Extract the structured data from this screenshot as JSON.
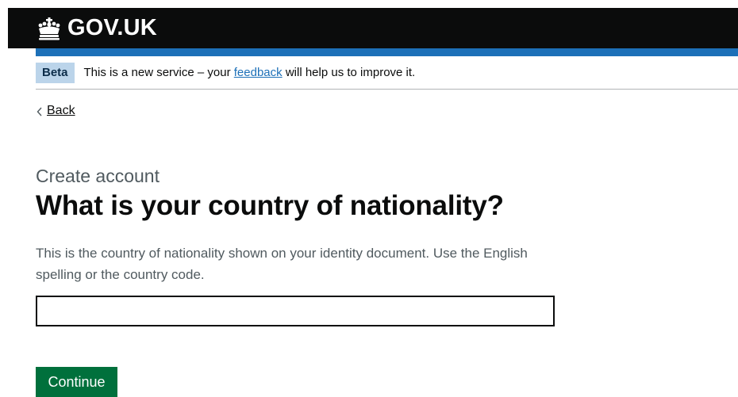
{
  "header": {
    "logo_text": "GOV.UK",
    "logo_icon": "crown-icon",
    "colors": {
      "background": "#0b0c0c",
      "stripe": "#1d70b8"
    }
  },
  "phase_banner": {
    "tag": "Beta",
    "text_before": "This is a new service – your ",
    "link_text": "feedback",
    "text_after": " will help us to improve it."
  },
  "back_link": {
    "label": "Back",
    "icon": "chevron-left-icon"
  },
  "main": {
    "caption": "Create account",
    "title": "What is your country of nationality?",
    "hint": "This is the country of nationality shown on your identity document. Use the English spelling or the country code.",
    "input": {
      "value": "",
      "placeholder": ""
    },
    "continue_label": "Continue"
  },
  "colors": {
    "button": "#00703c",
    "link": "#1d70b8",
    "tag_background": "#bbd4ea",
    "secondary_text": "#505a5f"
  }
}
